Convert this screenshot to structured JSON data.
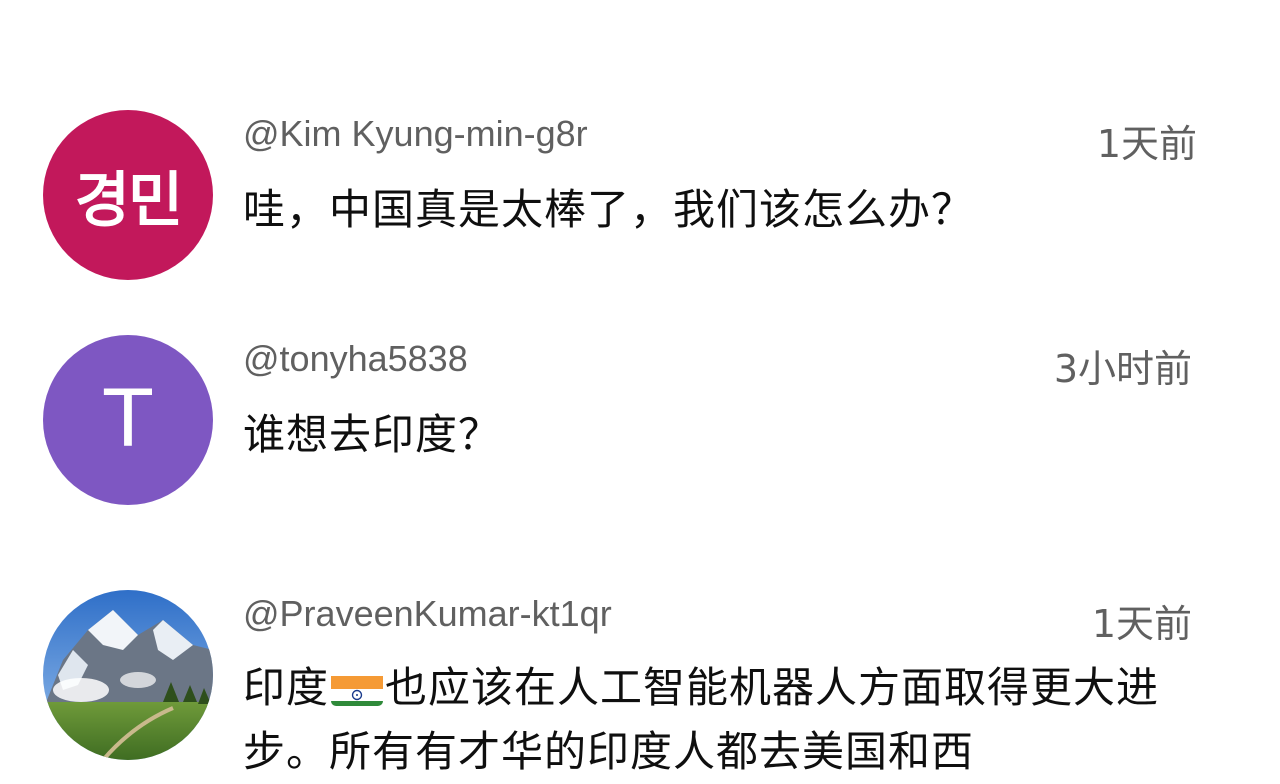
{
  "comments": [
    {
      "handle": "@Kim Kyung-min-g8r",
      "time": "1天前",
      "avatar_text": "경민",
      "avatar_color": "#c2185b",
      "text": "哇，中国真是太棒了，我们该怎么办？"
    },
    {
      "handle": "@tonyha5838",
      "time": "3小时前",
      "avatar_text": "T",
      "avatar_color": "#7e57c2",
      "text": "谁想去印度？"
    },
    {
      "handle": "@PraveenKumar-kt1qr",
      "time": "1天前",
      "avatar_icon": "mountain-landscape-photo",
      "text_before_flag": "印度",
      "flag_icon": "india-flag-emoji",
      "text_after_flag": "也应该在人工智能机器人方面取得更大进步。所有有才华的印度人都去美国和西"
    }
  ]
}
